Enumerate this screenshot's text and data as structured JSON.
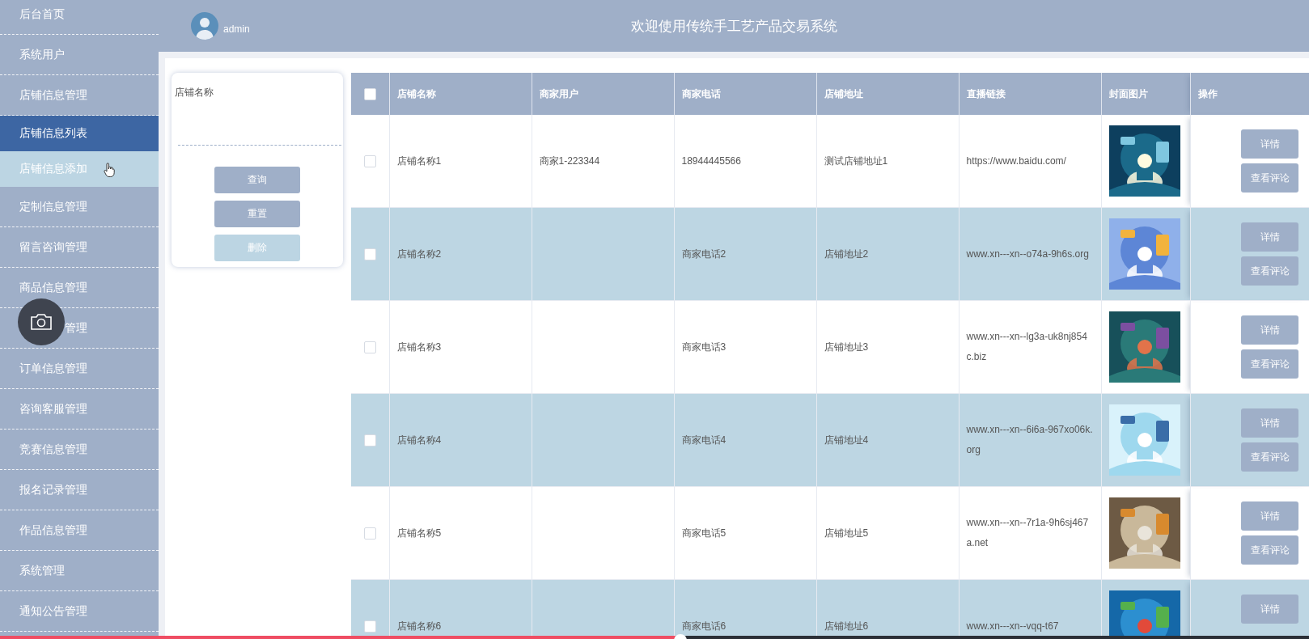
{
  "sidebar": {
    "items": [
      {
        "label": "后台首页",
        "selected": false
      },
      {
        "label": "系统用户",
        "selected": false
      },
      {
        "label": "店铺信息管理",
        "selected": false,
        "children": [
          {
            "label": "店铺信息列表",
            "selected": true,
            "hovered": false
          },
          {
            "label": "店铺信息添加",
            "selected": false,
            "hovered": true
          }
        ]
      },
      {
        "label": "定制信息管理",
        "selected": false
      },
      {
        "label": "留言咨询管理",
        "selected": false
      },
      {
        "label": "商品信息管理",
        "selected": false
      },
      {
        "label": "管理",
        "selected": false,
        "covered": true
      },
      {
        "label": "订单信息管理",
        "selected": false
      },
      {
        "label": "咨询客服管理",
        "selected": false
      },
      {
        "label": "竞赛信息管理",
        "selected": false
      },
      {
        "label": "报名记录管理",
        "selected": false
      },
      {
        "label": "作品信息管理",
        "selected": false
      },
      {
        "label": "系统管理",
        "selected": false
      },
      {
        "label": "通知公告管理",
        "selected": false
      }
    ]
  },
  "header": {
    "user": "admin",
    "title": "欢迎使用传统手工艺产品交易系统"
  },
  "search": {
    "label": "店铺名称",
    "buttons": [
      {
        "label": "查询",
        "disabled": false
      },
      {
        "label": "重置",
        "disabled": false
      },
      {
        "label": "删除",
        "disabled": true
      }
    ]
  },
  "table": {
    "select_all": {
      "checked": false
    },
    "columns": [
      "店铺名称",
      "商家用户",
      "商家电话",
      "店铺地址",
      "直播链接",
      "封面图片",
      "操作"
    ],
    "rows": [
      {
        "checked": false,
        "name": "店铺名称1",
        "user": "商家1-223344",
        "phone": "18944445566",
        "address": "测试店铺地址1",
        "link": "https://www.baidu.com/",
        "cover": {
          "kind": "picture"
        },
        "actions": [
          "详情",
          "查看评论"
        ]
      },
      {
        "checked": false,
        "name": "店铺名称2",
        "phone": "商家电话2",
        "address": "店铺地址2",
        "link": "www.xn---xn--o74a-9h6s.org",
        "cover": {
          "kind": "picture"
        },
        "actions": [
          "详情",
          "查看评论"
        ]
      },
      {
        "checked": false,
        "name": "店铺名称3",
        "phone": "商家电话3",
        "address": "店铺地址3",
        "link": "www.xn---xn--lg3a-uk8nj854c.biz",
        "cover": {
          "kind": "picture"
        },
        "actions": [
          "详情",
          "查看评论"
        ]
      },
      {
        "checked": false,
        "name": "店铺名称4",
        "phone": "商家电话4",
        "address": "店铺地址4",
        "link": "www.xn---xn--6i6a-967xo06k.org",
        "cover": {
          "kind": "picture"
        },
        "actions": [
          "详情",
          "查看评论"
        ]
      },
      {
        "checked": false,
        "name": "店铺名称5",
        "phone": "商家电话5",
        "address": "店铺地址5",
        "link": "www.xn---xn--7r1a-9h6sj467a.net",
        "cover": {
          "kind": "picture"
        },
        "actions": [
          "详情",
          "查看评论"
        ]
      },
      {
        "checked": false,
        "name": "店铺名称6",
        "phone": "商家电话6",
        "address": "店铺地址6",
        "link": "www.xn---xn--vqq-t67",
        "cover": {
          "kind": "picture"
        },
        "actions": [
          "详情"
        ]
      }
    ]
  },
  "video_bar": {
    "level": 0.52
  }
}
